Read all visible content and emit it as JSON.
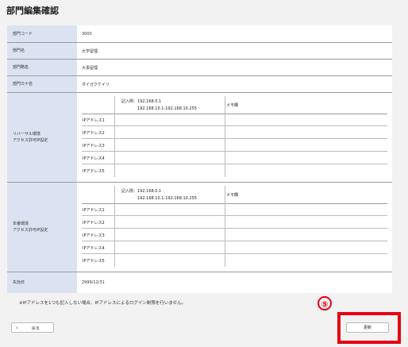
{
  "page": {
    "title": "部門編集確認"
  },
  "fields": {
    "dept_code": {
      "label": "部門コード",
      "value": "3000"
    },
    "dept_name": {
      "label": "部門名",
      "value": "大学留理"
    },
    "dept_short": {
      "label": "部門略名",
      "value": "大事留理"
    },
    "dept_kana": {
      "label": "部門カナ名",
      "value": "ダイガクケイリ"
    },
    "expiry": {
      "label": "失効日",
      "value": "2999/12/31"
    }
  },
  "ip_blocks": [
    {
      "label_line1": "リバーサル環境",
      "label_line2": "アクセス許可IP設定",
      "example_line1": "記入例：192.168.0.1",
      "example_line2": "192.168.10.1-192.168.10.255",
      "memo_header": "メモ欄",
      "rows": [
        "IPアドレス1",
        "IPアドレス2",
        "IPアドレス3",
        "IPアドレス4",
        "IPアドレス5"
      ]
    },
    {
      "label_line1": "本番環境",
      "label_line2": "アクセス許可IP設定",
      "example_line1": "記入例：192.168.0.1",
      "example_line2": "192.168.10.1-192.168.10.255",
      "memo_header": "メモ欄",
      "rows": [
        "IPアドレス1",
        "IPアドレス2",
        "IPアドレス3",
        "IPアドレス4",
        "IPアドレス5"
      ]
    }
  ],
  "note": "※IPアドレスを1つも記入しない場合、IPアドレスによるログイン制限を行いません。",
  "buttons": {
    "back": "戻る",
    "update": "更新",
    "back_icon": "chevron-left-icon"
  },
  "annotation": {
    "step": "⑤",
    "color": "#e60012"
  }
}
